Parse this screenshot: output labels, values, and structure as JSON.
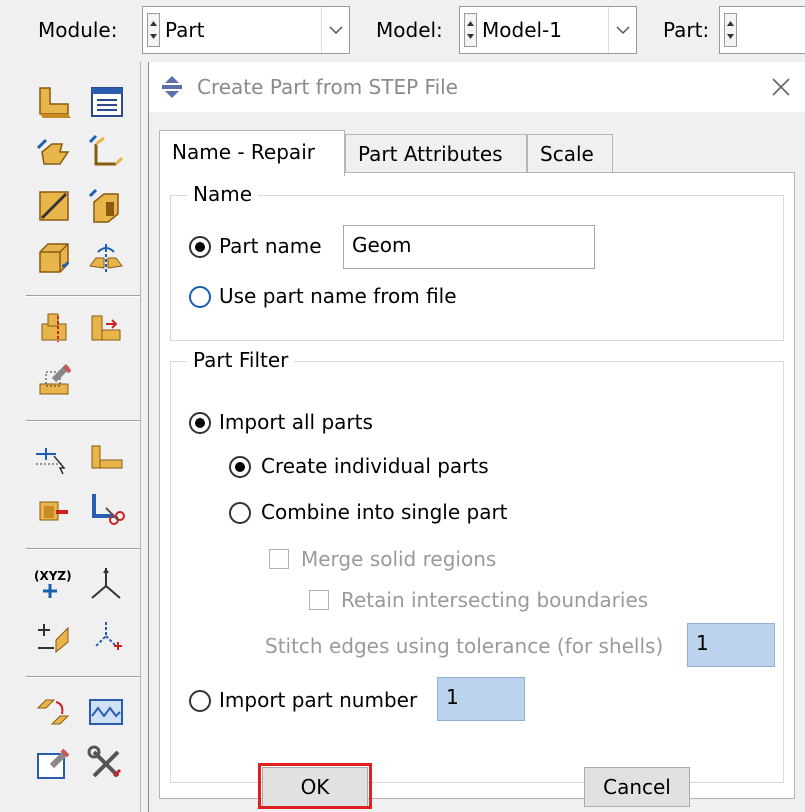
{
  "topbar": {
    "module_label": "Module:",
    "module_value": "Part",
    "model_label": "Model:",
    "model_value": "Model-1",
    "part_label": "Part:",
    "part_value": ""
  },
  "toolbox": {
    "icons": [
      "create-part-icon",
      "part-manager-icon",
      "create-solid-icon",
      "create-shell-icon",
      "create-wire-icon",
      "create-cut-icon",
      "create-round-icon",
      "mirror-icon",
      "partition-face-icon",
      "partition-cell-icon",
      "repair-icon",
      "datum-point-icon",
      "datum-axis-icon",
      "datum-plane-icon",
      "delete-feature-icon",
      "datum-csys-icon",
      "assembly-icon",
      "reference-point-icon",
      "datum-manager-icon",
      "geometry-edit-icon",
      "virtual-topology-icon",
      "query-icon",
      "tools-icon"
    ]
  },
  "dialog": {
    "title": "Create Part from STEP File",
    "tabs": [
      "Name - Repair",
      "Part Attributes",
      "Scale"
    ],
    "active_tab": "Name - Repair",
    "name_group": {
      "title": "Name",
      "part_name_label": "Part name",
      "part_name_value": "Geom",
      "use_file_name_label": "Use part name from file",
      "selected": "part_name"
    },
    "filter_group": {
      "title": "Part Filter",
      "import_all_label": "Import all parts",
      "create_individual_label": "Create individual parts",
      "combine_label": "Combine into single part",
      "merge_label": "Merge solid regions",
      "retain_label": "Retain intersecting boundaries",
      "stitch_label": "Stitch edges using tolerance (for shells)",
      "stitch_value": "1",
      "import_number_label": "Import part number",
      "import_number_value": "1",
      "selected": "import_all",
      "sub_selected": "create_individual"
    },
    "ok_label": "OK",
    "cancel_label": "Cancel"
  },
  "colors": {
    "highlight_box": "#e02020",
    "numeric_field": "#bcd3ee",
    "title_icon": "#5b6fa8"
  }
}
